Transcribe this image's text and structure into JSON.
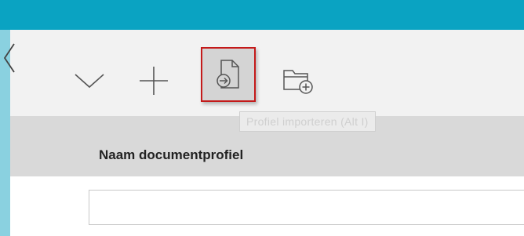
{
  "toolbar": {
    "back_icon": "chevron-left-icon",
    "collapse_icon": "chevron-down-icon",
    "add_icon": "plus-icon",
    "import_icon": "file-import-icon",
    "new_folder_icon": "folder-add-icon",
    "tooltip": "Profiel importeren   (Alt I)"
  },
  "table": {
    "column_header": "Naam documentprofiel",
    "input_value": ""
  },
  "colors": {
    "accent": "#0aa3c2",
    "side_strip": "#8ad1e0",
    "toolbar_bg": "#f2f2f2",
    "header_bg": "#d9d9d9",
    "highlight_border": "#c41a1a"
  }
}
